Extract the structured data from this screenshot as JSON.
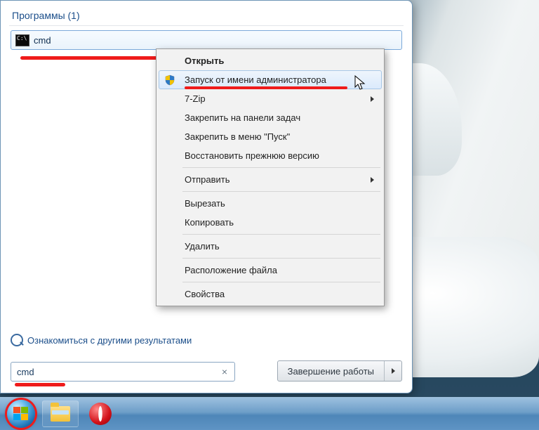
{
  "panel": {
    "section_head": "Программы (1)",
    "result_label": "cmd",
    "see_more": "Ознакомиться с другими результатами",
    "search_value": "cmd",
    "shutdown": "Завершение работы"
  },
  "context_menu": {
    "open": "Открыть",
    "run_as_admin": "Запуск от имени администратора",
    "seven_zip": "7-Zip",
    "pin_taskbar": "Закрепить на панели задач",
    "pin_start": "Закрепить в меню \"Пуск\"",
    "restore_prev": "Восстановить прежнюю версию",
    "send_to": "Отправить",
    "cut": "Вырезать",
    "copy": "Копировать",
    "delete": "Удалить",
    "open_location": "Расположение файла",
    "properties": "Свойства"
  }
}
